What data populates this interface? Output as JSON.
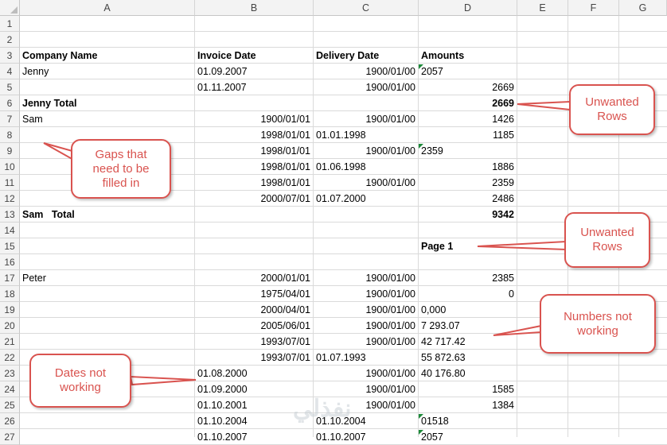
{
  "columns": [
    "A",
    "B",
    "C",
    "D",
    "E",
    "F",
    "G"
  ],
  "rows": [
    "1",
    "2",
    "3",
    "4",
    "5",
    "6",
    "7",
    "8",
    "9",
    "10",
    "11",
    "12",
    "13",
    "14",
    "15",
    "16",
    "17",
    "18",
    "19",
    "20",
    "21",
    "22",
    "23",
    "24",
    "25",
    "26",
    "27"
  ],
  "cells": {
    "r3": {
      "a": "Company Name",
      "b": "Invoice Date",
      "c": "Delivery Date",
      "d": "Amounts"
    },
    "r4": {
      "a": "Jenny",
      "b": "01.09.2007",
      "c": "1900/01/00",
      "d": "2057"
    },
    "r5": {
      "b": "01.11.2007",
      "c": "1900/01/00",
      "d": "2669"
    },
    "r6": {
      "a": "Jenny Total",
      "d": "2669"
    },
    "r7": {
      "a": "Sam",
      "b": "1900/01/01",
      "c": "1900/01/00",
      "d": "1426"
    },
    "r8": {
      "b": "1998/01/01",
      "c": "01.01.1998",
      "d": "1185"
    },
    "r9": {
      "b": "1998/01/01",
      "c": "1900/01/00",
      "d": "2359"
    },
    "r10": {
      "b": "1998/01/01",
      "c": "01.06.1998",
      "d": "1886"
    },
    "r11": {
      "b": "1998/01/01",
      "c": "1900/01/00",
      "d": "2359"
    },
    "r12": {
      "b": "2000/07/01",
      "c": "01.07.2000",
      "d": "2486"
    },
    "r13": {
      "a": "Sam   Total",
      "d": "9342"
    },
    "r15": {
      "d": "Page 1"
    },
    "r17": {
      "a": "Peter",
      "b": "2000/01/01",
      "c": "1900/01/00",
      "d": "2385"
    },
    "r18": {
      "b": "1975/04/01",
      "c": "1900/01/00",
      "d": "0"
    },
    "r19": {
      "b": "2000/04/01",
      "c": "1900/01/00",
      "d": "0,000"
    },
    "r20": {
      "b": "2005/06/01",
      "c": "1900/01/00",
      "d": "7 293.07"
    },
    "r21": {
      "b": "1993/07/01",
      "c": "1900/01/00",
      "d": "42 717.42"
    },
    "r22": {
      "b": "1993/07/01",
      "c": "01.07.1993",
      "d": "55 872.63"
    },
    "r23": {
      "b": "01.08.2000",
      "c": "1900/01/00",
      "d": "40 176.80"
    },
    "r24": {
      "b": "01.09.2000",
      "c": "1900/01/00",
      "d": "1585"
    },
    "r25": {
      "b": "01.10.2001",
      "c": "1900/01/00",
      "d": "1384"
    },
    "r26": {
      "b": "01.10.2004",
      "c": "01.10.2004",
      "d": "01518"
    },
    "r27": {
      "b": "01.10.2007",
      "c": "01.10.2007",
      "d": "2057"
    }
  },
  "callouts": {
    "unwanted_rows_1": "Unwanted Rows",
    "gaps": "Gaps that need to be filled in",
    "unwanted_rows_2": "Unwanted Rows",
    "numbers": "Numbers not working",
    "dates": "Dates not working"
  },
  "watermark": "نفذلي",
  "colors": {
    "callout": "#d9534f",
    "error_indicator": "#1d8a3a",
    "header_bg": "#f3f3f3",
    "grid": "#dadada"
  }
}
